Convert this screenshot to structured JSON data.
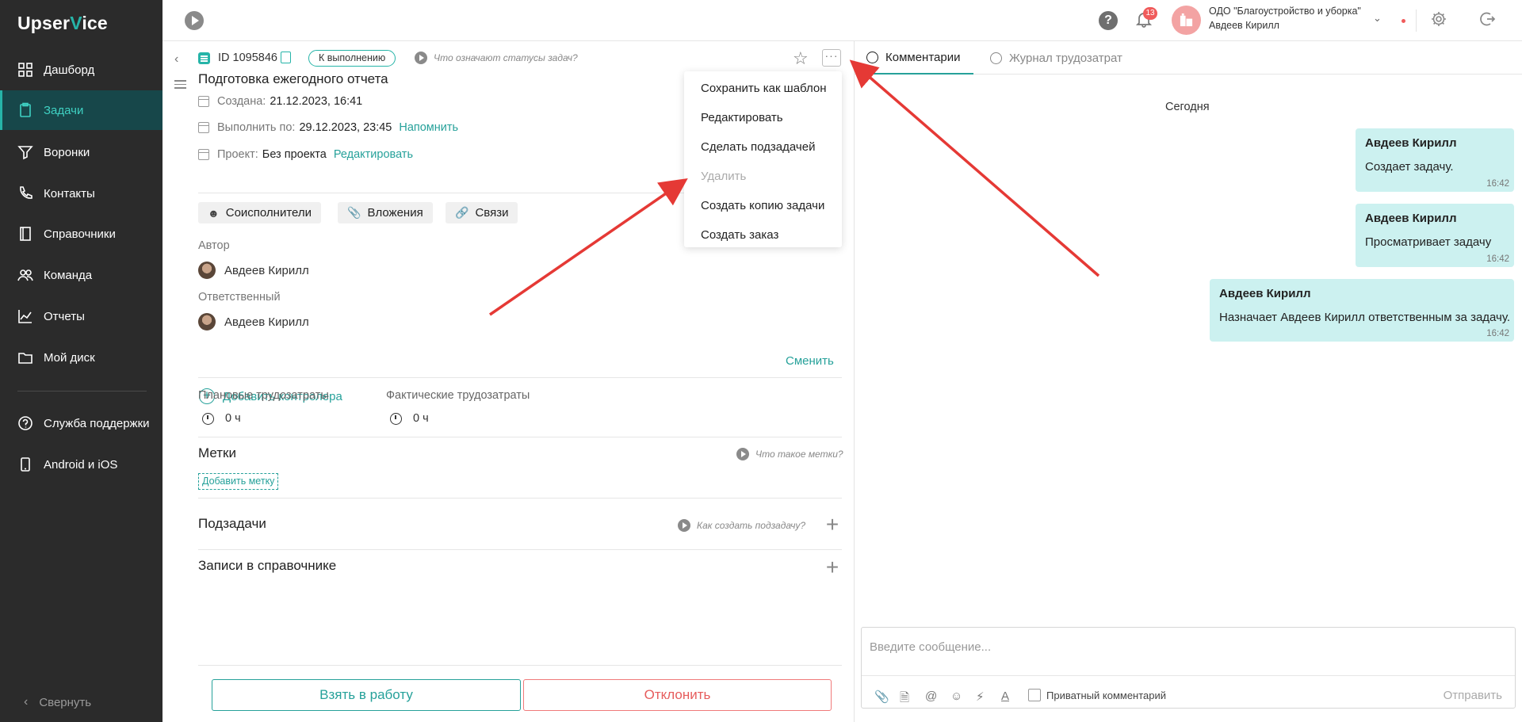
{
  "brand": {
    "name_a": "Upser",
    "name_b": "V",
    "name_c": "ice",
    "accent": "#26b4a8"
  },
  "sidebar": {
    "items": [
      {
        "label": "Дашборд",
        "icon": "dashboard-icon"
      },
      {
        "label": "Задачи",
        "icon": "tasks-icon",
        "active": true
      },
      {
        "label": "Воронки",
        "icon": "funnel-icon"
      },
      {
        "label": "Контакты",
        "icon": "phone-icon"
      },
      {
        "label": "Справочники",
        "icon": "book-icon"
      },
      {
        "label": "Команда",
        "icon": "team-icon"
      },
      {
        "label": "Отчеты",
        "icon": "chart-icon"
      },
      {
        "label": "Мой диск",
        "icon": "folder-icon"
      }
    ],
    "support": [
      {
        "label": "Служба поддержки",
        "icon": "help-icon"
      },
      {
        "label": "Android и iOS",
        "icon": "mobile-icon"
      }
    ],
    "collapse_label": "Свернуть"
  },
  "topbar": {
    "notifications_count": "13",
    "org_name": "ОДО \"Благоустройство и уборка\"",
    "user_name": "Авдеев Кирилл"
  },
  "task": {
    "id": "ID 1095846",
    "status": "К выполнению",
    "status_help": "Что означают статусы задач?",
    "title": "Подготовка ежегодного отчета",
    "created_label": "Создана:",
    "created_value": "21.12.2023, 16:41",
    "due_label": "Выполнить по:",
    "due_value": "29.12.2023, 23:45",
    "remind_link": "Напомнить",
    "project_label": "Проект:",
    "project_value": "Без проекта",
    "edit_link": "Редактировать",
    "chips": [
      "Соисполнители",
      "Вложения",
      "Связи"
    ],
    "author_label": "Автор",
    "author_name": "Авдеев Кирилл",
    "responsible_label": "Ответственный",
    "responsible_name": "Авдеев Кирилл",
    "change_link": "Сменить",
    "add_controller": "Добавить контролера",
    "planned_label": "Плановые трудозатраты",
    "planned_value": "0 ч",
    "actual_label": "Фактические трудозатраты",
    "actual_value": "0 ч",
    "tags_title": "Метки",
    "tags_help": "Что такое метки?",
    "add_tag": "Добавить метку",
    "subtasks_title": "Подзадачи",
    "subtasks_help": "Как создать подзадачу?",
    "records_title": "Записи в справочнике",
    "take_button": "Взять в работу",
    "reject_button": "Отклонить"
  },
  "menu": {
    "items": [
      {
        "label": "Сохранить как шаблон",
        "disabled": false
      },
      {
        "label": "Редактировать",
        "disabled": false
      },
      {
        "label": "Сделать подзадачей",
        "disabled": false
      },
      {
        "label": "Удалить",
        "disabled": true
      },
      {
        "label": "Создать копию задачи",
        "disabled": false
      },
      {
        "label": "Создать заказ",
        "disabled": false
      }
    ]
  },
  "comments": {
    "tabs": [
      "Комментарии",
      "Журнал трудозатрат"
    ],
    "day_label": "Сегодня",
    "messages": [
      {
        "author": "Авдеев Кирилл",
        "text": "Создает задачу.",
        "time": "16:42"
      },
      {
        "author": "Авдеев Кирилл",
        "text": "Просматривает задачу",
        "time": "16:42"
      },
      {
        "author": "Авдеев Кирилл",
        "text": "Назначает Авдеев Кирилл ответственным за задачу.",
        "time": "16:42"
      }
    ],
    "input_placeholder": "Введите сообщение...",
    "private_label": "Приватный комментарий",
    "send_label": "Отправить"
  }
}
